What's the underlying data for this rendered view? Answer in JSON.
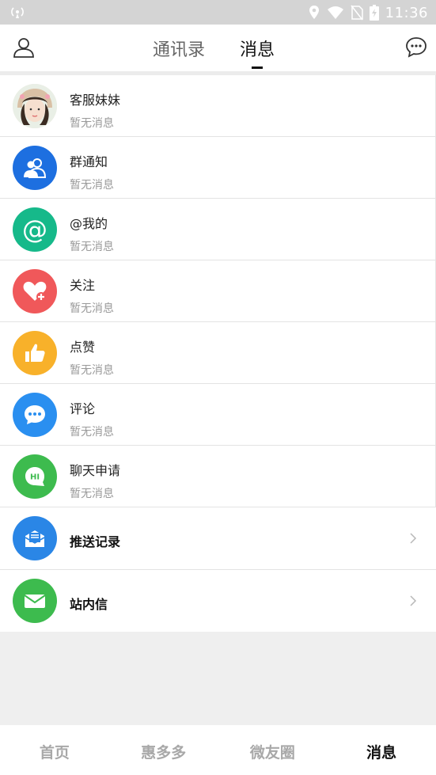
{
  "status_bar": {
    "time": "11:36"
  },
  "header": {
    "tabs": [
      {
        "label": "通讯录"
      },
      {
        "label": "消息"
      }
    ],
    "active_tab": "消息"
  },
  "messages": [
    {
      "title": "客服妹妹",
      "preview": "暂无消息",
      "icon": "customer-service-avatar"
    },
    {
      "title": "群通知",
      "preview": "暂无消息",
      "icon": "group-icon",
      "color": "#1d6fe0"
    },
    {
      "title": "@我的",
      "preview": "暂无消息",
      "icon": "at-icon",
      "color": "#16b98a"
    },
    {
      "title": "关注",
      "preview": "暂无消息",
      "icon": "heart-plus-icon",
      "color": "#f0585a"
    },
    {
      "title": "点赞",
      "preview": "暂无消息",
      "icon": "thumbs-up-icon",
      "color": "#f8b12a"
    },
    {
      "title": "评论",
      "preview": "暂无消息",
      "icon": "comment-icon",
      "color": "#2a8ff0"
    },
    {
      "title": "聊天申请",
      "preview": "暂无消息",
      "icon": "chat-request-icon",
      "color": "#3dbb4e"
    }
  ],
  "links": [
    {
      "title": "推送记录",
      "icon": "push-record-icon",
      "color": "#2a86e6"
    },
    {
      "title": "站内信",
      "icon": "mail-icon",
      "color": "#3dbb4e"
    }
  ],
  "bottom_nav": {
    "items": [
      {
        "label": "首页"
      },
      {
        "label": "惠多多"
      },
      {
        "label": "微友圈"
      },
      {
        "label": "消息"
      }
    ],
    "active": "消息"
  }
}
